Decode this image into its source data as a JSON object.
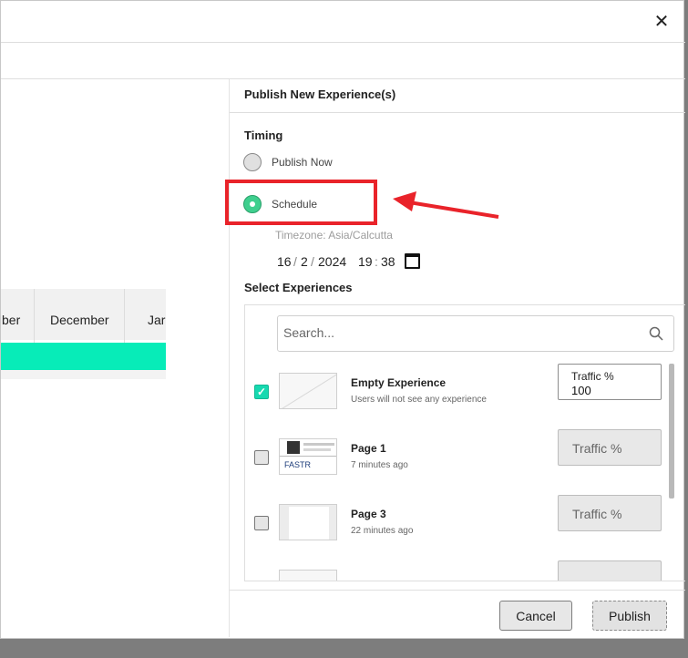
{
  "dialog": {
    "close_label": "✕"
  },
  "timeline": {
    "months": [
      "ber",
      "December",
      "Jar"
    ],
    "bar_color": "#07ecb8"
  },
  "publish_panel": {
    "title": "Publish New Experience(s)",
    "timing": {
      "label": "Timing",
      "options": [
        {
          "label": "Publish Now",
          "selected": false
        },
        {
          "label": "Schedule",
          "selected": true
        }
      ],
      "timezone": "Timezone: Asia/Calcutta",
      "date": {
        "day": "16",
        "month": "2",
        "year": "2024",
        "hour": "19",
        "minute": "38",
        "date_sep": "/",
        "time_sep": ":"
      }
    },
    "select": {
      "label": "Select Experiences",
      "search_placeholder": "Search...",
      "experiences": [
        {
          "name": "Empty Experience",
          "description": "Users will not see any experience",
          "checked": true,
          "traffic_label": "Traffic %",
          "traffic_value": "100"
        },
        {
          "name": "Page 1",
          "description": "7 minutes ago",
          "checked": false,
          "traffic_placeholder": "Traffic %",
          "thumb_text": "FASTR"
        },
        {
          "name": "Page 3",
          "description": "22 minutes ago",
          "checked": false,
          "traffic_placeholder": "Traffic %"
        }
      ]
    },
    "buttons": {
      "cancel": "Cancel",
      "publish": "Publish"
    }
  },
  "annotation": {
    "highlight_color": "#e9232a"
  },
  "colors": {
    "accent": "#3fcf8e",
    "checkbox_on": "#16d9b0"
  }
}
